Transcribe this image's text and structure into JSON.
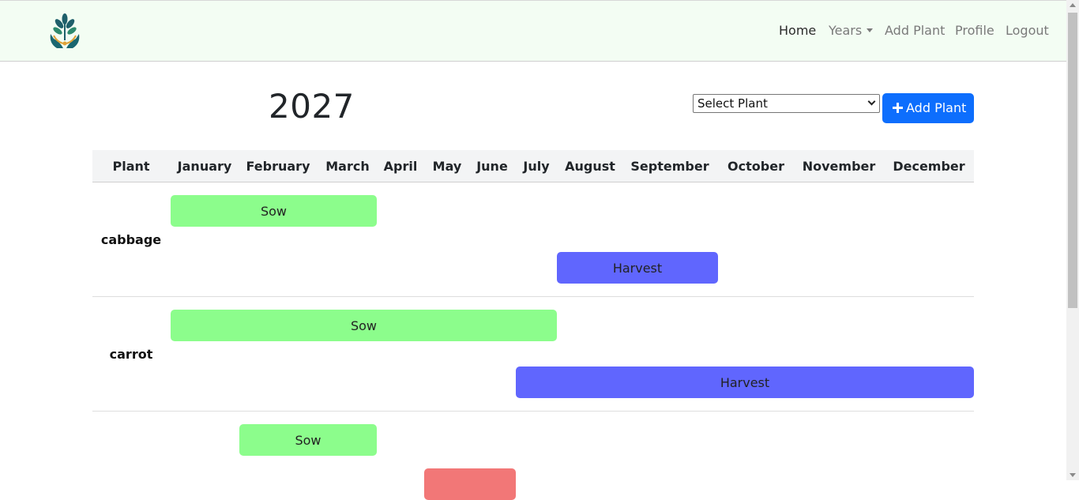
{
  "navbar": {
    "logo_icon": "plant-hands-logo-icon",
    "links": {
      "home": "Home",
      "years": "Years",
      "add_plant": "Add Plant",
      "profile": "Profile",
      "logout": "Logout"
    }
  },
  "page": {
    "year": "2027",
    "select": {
      "selected": "Select Plant"
    },
    "add_button": {
      "label": "Add Plant",
      "icon": "plus-icon",
      "color": "#0d6efd"
    }
  },
  "table": {
    "headers": [
      "Plant",
      "January",
      "February",
      "March",
      "April",
      "May",
      "June",
      "July",
      "August",
      "September",
      "October",
      "November",
      "December"
    ],
    "rows": [
      {
        "plant": "cabbage",
        "sow_label": "Sow",
        "harvest_label": "Harvest"
      },
      {
        "plant": "carrot",
        "sow_label": "Sow",
        "harvest_label": "Harvest"
      },
      {
        "plant": "",
        "sow_label": "Sow",
        "transplant_label": ""
      }
    ]
  },
  "colors": {
    "sow": "#8cfd8c",
    "harvest": "#6066fe",
    "transplant": "#f27777"
  }
}
